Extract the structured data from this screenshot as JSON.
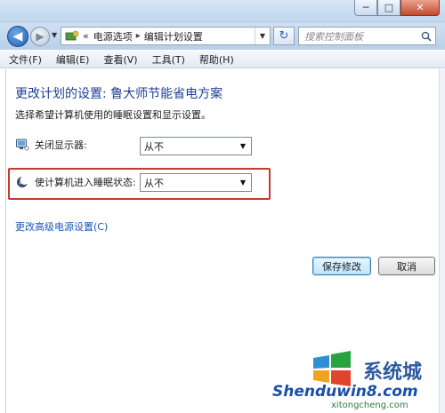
{
  "window": {
    "caption_buttons": {
      "minimize": "─",
      "maximize": "□",
      "close": "✕"
    }
  },
  "nav": {
    "back_glyph": "◀",
    "forward_glyph": "▶",
    "breadcrumb_lead": "«",
    "breadcrumbs": [
      "电源选项",
      "编辑计划设置"
    ],
    "breadcrumb_separator": "▸",
    "refresh_glyph": "↻",
    "search_placeholder": "搜索控制面板"
  },
  "menubar": {
    "items": [
      "文件(F)",
      "编辑(E)",
      "查看(V)",
      "工具(T)",
      "帮助(H)"
    ]
  },
  "main": {
    "title": "更改计划的设置: 鲁大师节能省电方案",
    "subtitle": "选择希望计算机使用的睡眠设置和显示设置。",
    "settings": [
      {
        "label": "关闭显示器:",
        "value": "从不",
        "icon": "monitor-icon"
      },
      {
        "label": "使计算机进入睡眠状态:",
        "value": "从不",
        "icon": "moon-icon"
      }
    ],
    "advanced_link": "更改高级电源设置(C)",
    "save_button": "保存修改",
    "cancel_button": "取消"
  },
  "watermark": {
    "cn": "系统城",
    "brand": "Shenduwin8.com",
    "site": "xitongcheng.com"
  },
  "colors": {
    "title_blue": "#1c3f94",
    "link_blue": "#1a56b8",
    "highlight_red": "#c43a2f"
  }
}
